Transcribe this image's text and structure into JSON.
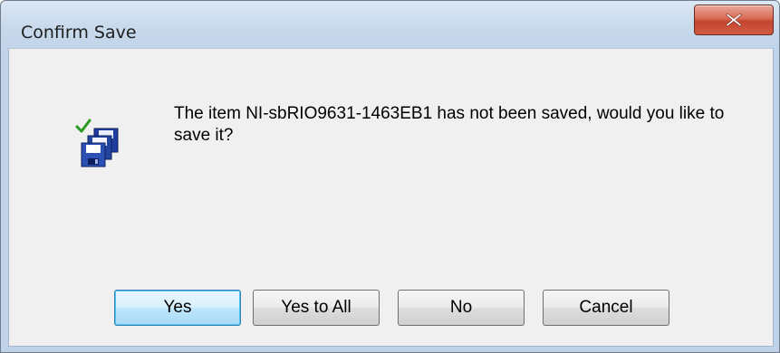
{
  "window": {
    "title": "Confirm Save",
    "close_icon": "close-x-icon"
  },
  "dialog": {
    "icon": "save-disks-check-icon",
    "message": "The item NI-sbRIO9631-1463EB1 has not been saved, would you like to save it?"
  },
  "buttons": {
    "yes": "Yes",
    "yes_to_all": "Yes to All",
    "no": "No",
    "cancel": "Cancel"
  },
  "colors": {
    "close_button": "#d05a44",
    "default_button_border": "#3c7fb1",
    "check_mark": "#2a9a1e",
    "disk_blue": "#1f3d9c"
  }
}
